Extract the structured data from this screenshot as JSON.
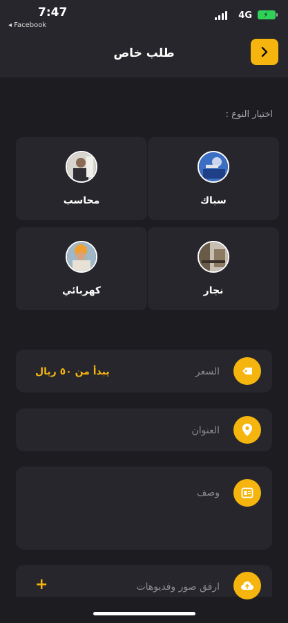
{
  "status_bar": {
    "time": "7:47",
    "back_app": "◂ Facebook",
    "network": "4G"
  },
  "header": {
    "title": "طلب خاص",
    "back_icon": "chevron-right-icon"
  },
  "section": {
    "type_label": "اختيار النوع :"
  },
  "categories": [
    {
      "label": "سباك",
      "icon": "plumber-avatar"
    },
    {
      "label": "محاسب",
      "icon": "accountant-avatar"
    },
    {
      "label": "نجار",
      "icon": "carpenter-avatar"
    },
    {
      "label": "كهربائي",
      "icon": "electrician-avatar"
    }
  ],
  "fields": {
    "price": {
      "label": "السعر",
      "value": "يبدأ من ٥٠ ريال",
      "icon": "price-tag-icon"
    },
    "address": {
      "label": "العنوان",
      "icon": "location-pin-icon"
    },
    "description": {
      "label": "وصف",
      "icon": "document-icon"
    },
    "attachments": {
      "label": "ارفق صور وفديوهات",
      "action": "+",
      "icon": "upload-cloud-icon"
    }
  },
  "colors": {
    "accent": "#f5b50e",
    "background": "#1c1c21",
    "card": "#26262c",
    "muted_text": "#8a8a90"
  }
}
